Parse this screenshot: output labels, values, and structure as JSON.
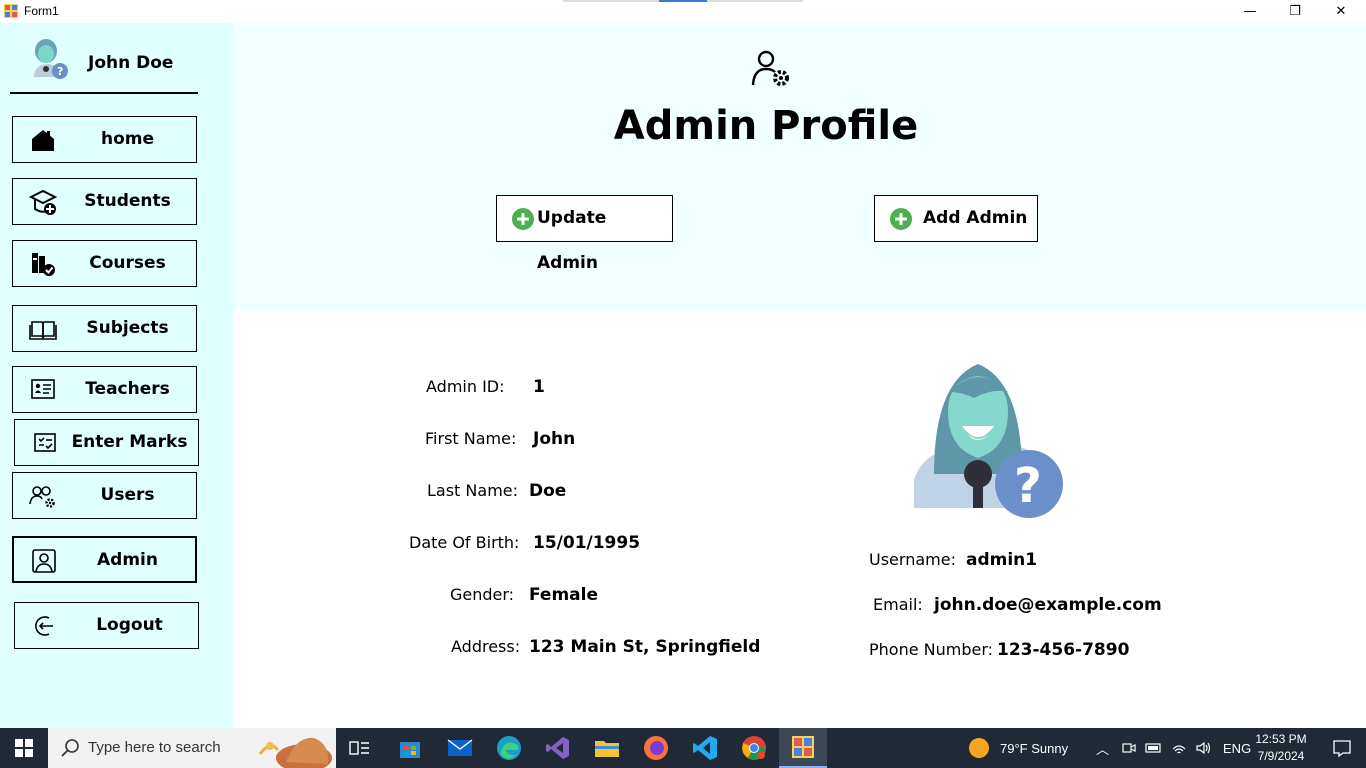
{
  "window": {
    "title": "Form1",
    "minimize": "—",
    "maximize": "❐",
    "close": "✕"
  },
  "sidebar": {
    "user_name": "John Doe",
    "items": [
      {
        "label": "home",
        "icon": "home-icon"
      },
      {
        "label": "Students",
        "icon": "student-add-icon"
      },
      {
        "label": "Courses",
        "icon": "courses-icon"
      },
      {
        "label": "Subjects",
        "icon": "book-icon"
      },
      {
        "label": "Teachers",
        "icon": "teacher-board-icon"
      },
      {
        "label": "Enter Marks",
        "icon": "marks-checklist-icon"
      },
      {
        "label": "Users",
        "icon": "users-gear-icon"
      },
      {
        "label": "Admin",
        "icon": "admin-portrait-icon"
      },
      {
        "label": "Logout",
        "icon": "logout-icon"
      }
    ],
    "active_item": "Admin"
  },
  "header": {
    "title": "Admin Profile",
    "update_button": "Update Admin",
    "add_button": "Add Admin"
  },
  "details": {
    "admin_id_label": "Admin ID:",
    "admin_id": "1",
    "first_name_label": "First Name:",
    "first_name": "John",
    "last_name_label": "Last Name:",
    "last_name": "Doe",
    "dob_label": "Date Of Birth:",
    "dob": "15/01/1995",
    "gender_label": "Gender:",
    "gender": "Female",
    "address_label": "Address:",
    "address": "123 Main St, Springfield",
    "username_label": "Username:",
    "username": "admin1",
    "email_label": "Email:",
    "email": "john.doe@example.com",
    "phone_label": "Phone Number:",
    "phone": "123-456-7890"
  },
  "taskbar": {
    "search_placeholder": "Type here to search",
    "weather": "79°F  Sunny",
    "language": "ENG",
    "time": "12:53 PM",
    "date": "7/9/2024"
  },
  "colors": {
    "sidebar_bg": "#e0ffff",
    "header_bg": "#f0ffff",
    "plus_green": "#4caf50",
    "taskbar_bg": "#1f2a36"
  }
}
